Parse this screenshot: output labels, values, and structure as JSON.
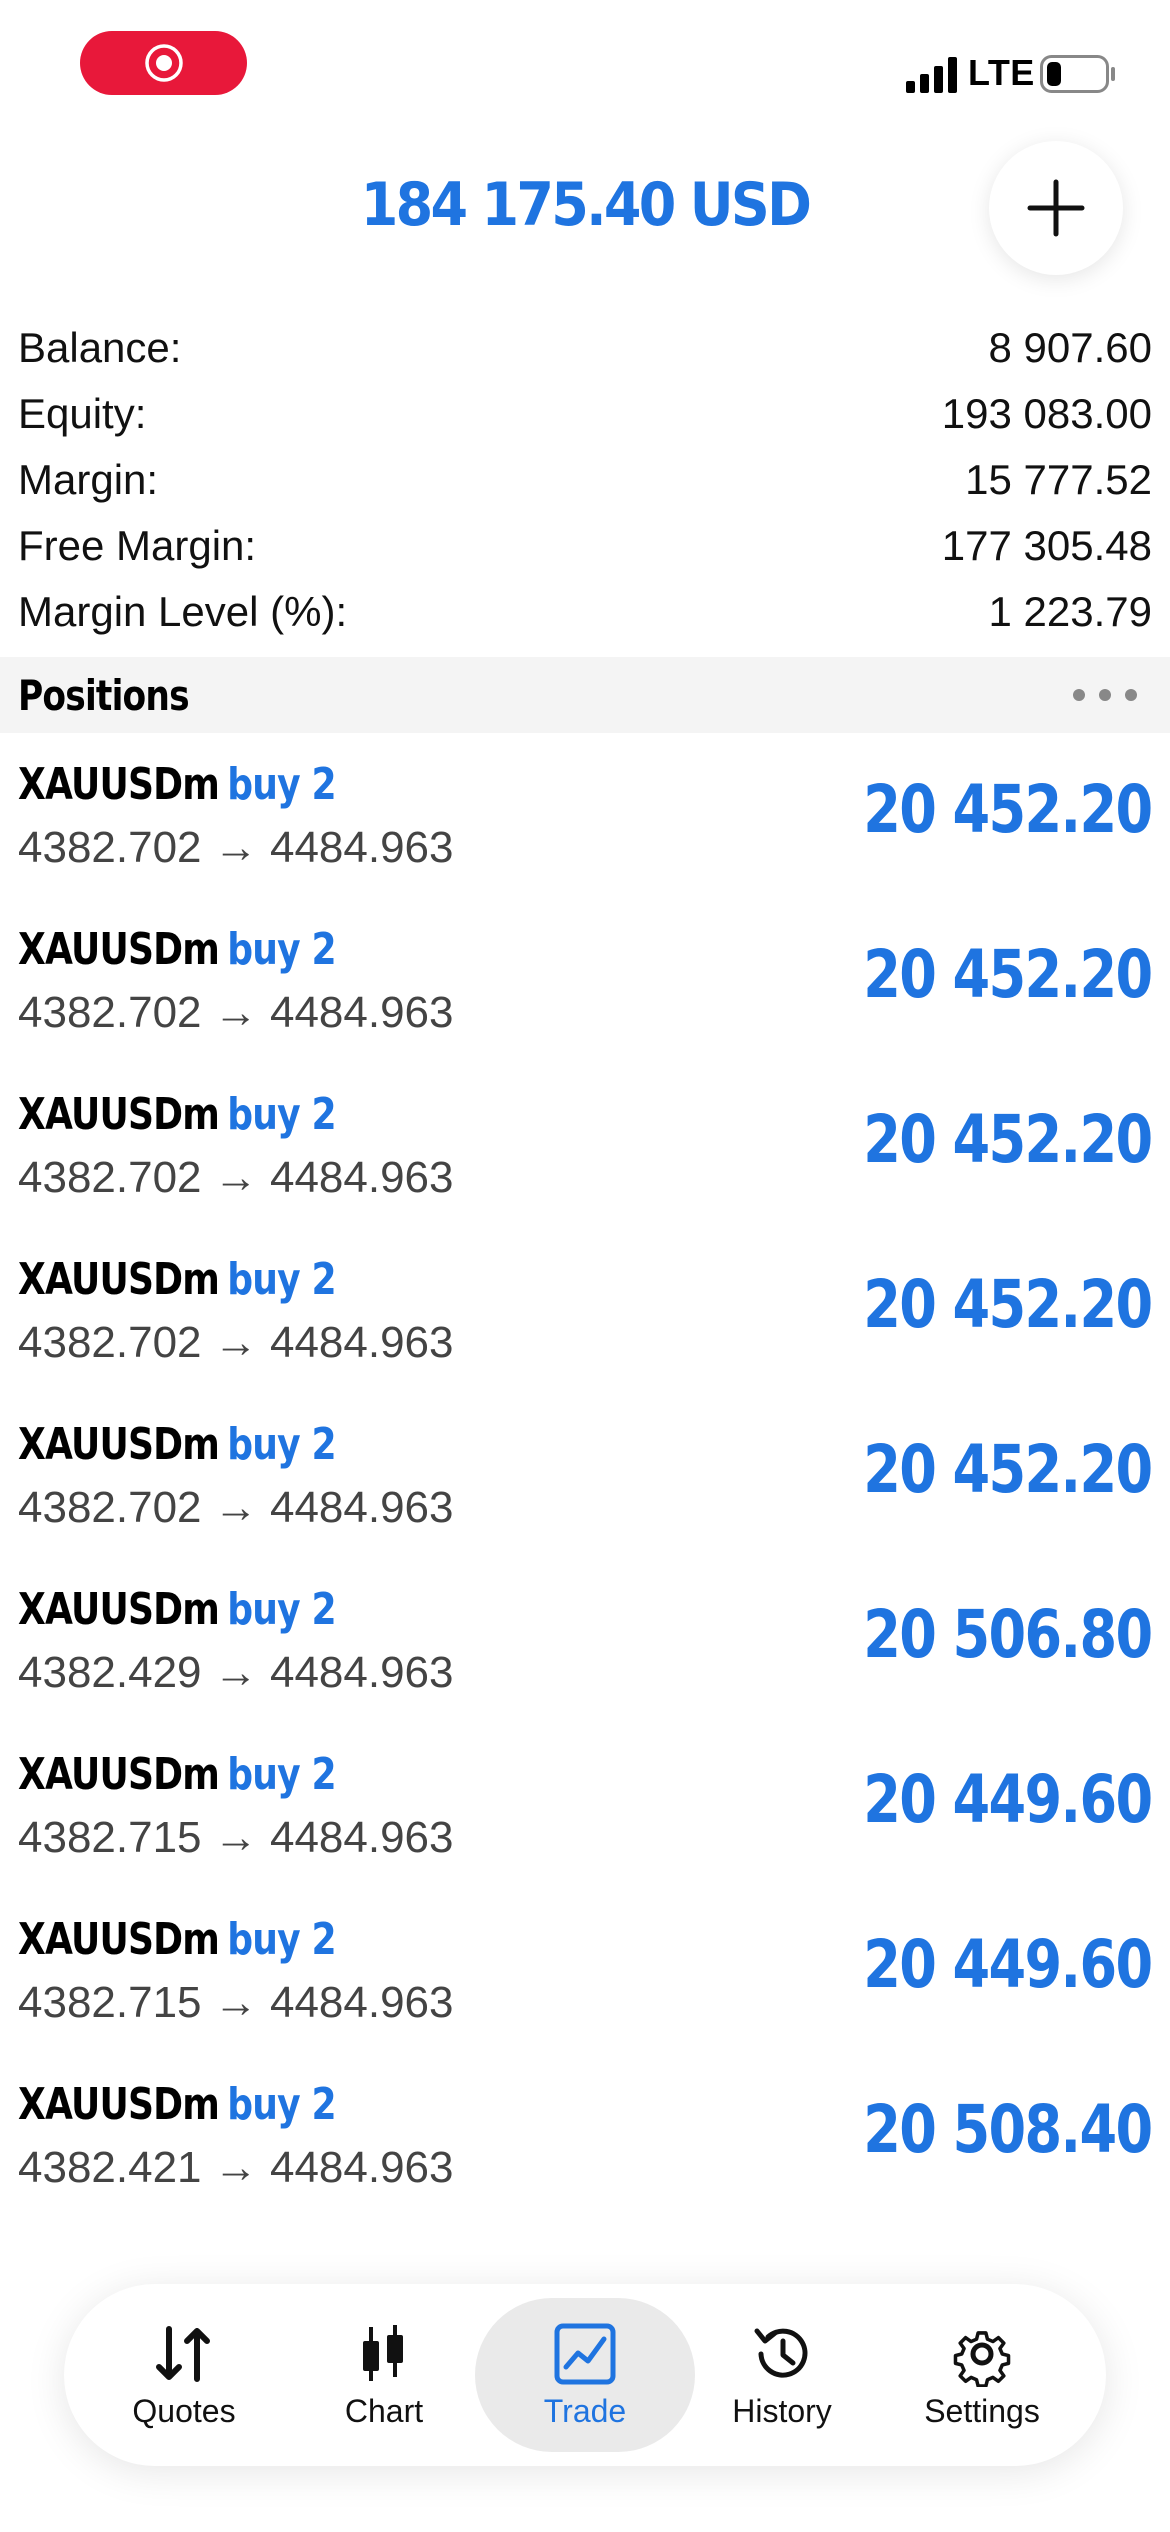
{
  "status_bar": {
    "network": "LTE",
    "battery_level": 0.25
  },
  "header": {
    "total": "184 175.40 USD"
  },
  "summary": [
    {
      "label": "Balance:",
      "value": "8 907.60"
    },
    {
      "label": "Equity:",
      "value": "193 083.00"
    },
    {
      "label": "Margin:",
      "value": "15 777.52"
    },
    {
      "label": "Free Margin:",
      "value": "177 305.48"
    },
    {
      "label": "Margin Level (%):",
      "value": "1 223.79"
    }
  ],
  "positions_section": {
    "title": "Positions"
  },
  "positions": [
    {
      "symbol": "XAUUSDm",
      "side": "buy 2",
      "prices": "4382.702 → 4484.963",
      "profit": "20 452.20"
    },
    {
      "symbol": "XAUUSDm",
      "side": "buy 2",
      "prices": "4382.702 → 4484.963",
      "profit": "20 452.20"
    },
    {
      "symbol": "XAUUSDm",
      "side": "buy 2",
      "prices": "4382.702 → 4484.963",
      "profit": "20 452.20"
    },
    {
      "symbol": "XAUUSDm",
      "side": "buy 2",
      "prices": "4382.702 → 4484.963",
      "profit": "20 452.20"
    },
    {
      "symbol": "XAUUSDm",
      "side": "buy 2",
      "prices": "4382.702 → 4484.963",
      "profit": "20 452.20"
    },
    {
      "symbol": "XAUUSDm",
      "side": "buy 2",
      "prices": "4382.429 → 4484.963",
      "profit": "20 506.80"
    },
    {
      "symbol": "XAUUSDm",
      "side": "buy 2",
      "prices": "4382.715 → 4484.963",
      "profit": "20 449.60"
    },
    {
      "symbol": "XAUUSDm",
      "side": "buy 2",
      "prices": "4382.715 → 4484.963",
      "profit": "20 449.60"
    },
    {
      "symbol": "XAUUSDm",
      "side": "buy 2",
      "prices": "4382.421 → 4484.963",
      "profit": "20 508.40"
    }
  ],
  "tabs": [
    {
      "label": "Quotes",
      "icon": "quotes-icon",
      "active": false
    },
    {
      "label": "Chart",
      "icon": "chart-icon",
      "active": false
    },
    {
      "label": "Trade",
      "icon": "trade-icon",
      "active": true
    },
    {
      "label": "History",
      "icon": "history-icon",
      "active": false
    },
    {
      "label": "Settings",
      "icon": "settings-icon",
      "active": false
    }
  ],
  "colors": {
    "accent": "#1f74e0",
    "record": "#e8183a",
    "section_bg": "#f4f4f4"
  }
}
